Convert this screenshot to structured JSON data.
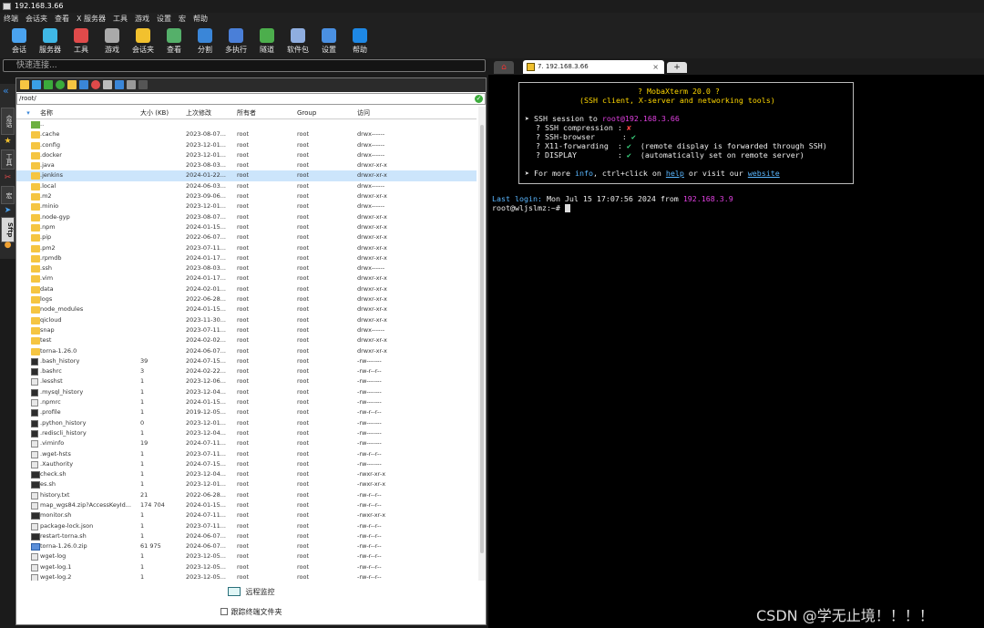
{
  "window": {
    "title": "192.168.3.66"
  },
  "menu": [
    "终端",
    "会话夹",
    "查看",
    "X 服务器",
    "工具",
    "游戏",
    "设置",
    "宏",
    "帮助"
  ],
  "toolbar": [
    {
      "label": "会话",
      "icon": "session-icon",
      "color": "#4aa3f0"
    },
    {
      "label": "服务器",
      "icon": "servers-icon",
      "color": "#3fb8e6"
    },
    {
      "label": "工具",
      "icon": "tools-icon",
      "color": "#e04a4a"
    },
    {
      "label": "游戏",
      "icon": "games-icon",
      "color": "#aaaaaa"
    },
    {
      "label": "会话夹",
      "icon": "star-icon",
      "color": "#f2c12e"
    },
    {
      "label": "查看",
      "icon": "view-icon",
      "color": "#55b06a"
    },
    {
      "label": "分割",
      "icon": "split-icon",
      "color": "#3a86d8"
    },
    {
      "label": "多执行",
      "icon": "multiexec-icon",
      "color": "#4a7fd8"
    },
    {
      "label": "隧道",
      "icon": "tunnel-icon",
      "color": "#4cae4c"
    },
    {
      "label": "软件包",
      "icon": "packages-icon",
      "color": "#8faee0"
    },
    {
      "label": "设置",
      "icon": "settings-icon",
      "color": "#4a90e2"
    },
    {
      "label": "帮助",
      "icon": "help-icon",
      "color": "#1e88e5"
    }
  ],
  "quick_connect": {
    "placeholder": "快速连接..."
  },
  "sidebar": {
    "tabs": [
      "会话",
      "工具",
      "宏",
      "Sftp"
    ]
  },
  "browser": {
    "path": "/root/",
    "columns": [
      "名称",
      "大小 (KB)",
      "上次修改",
      "所有者",
      "Group",
      "访问"
    ],
    "files": [
      {
        "name": "..",
        "size": "",
        "modified": "",
        "owner": "",
        "group": "",
        "access": "",
        "type": "up"
      },
      {
        "name": ".cache",
        "size": "",
        "modified": "2023-08-07...",
        "owner": "root",
        "group": "root",
        "access": "drwx------",
        "type": "folder"
      },
      {
        "name": ".config",
        "size": "",
        "modified": "2023-12-01...",
        "owner": "root",
        "group": "root",
        "access": "drwx------",
        "type": "folder"
      },
      {
        "name": ".docker",
        "size": "",
        "modified": "2023-12-01...",
        "owner": "root",
        "group": "root",
        "access": "drwx------",
        "type": "folder"
      },
      {
        "name": ".java",
        "size": "",
        "modified": "2023-08-03...",
        "owner": "root",
        "group": "root",
        "access": "drwxr-xr-x",
        "type": "folder"
      },
      {
        "name": ".jenkins",
        "size": "",
        "modified": "2024-01-22...",
        "owner": "root",
        "group": "root",
        "access": "drwxr-xr-x",
        "type": "folder",
        "selected": true
      },
      {
        "name": ".local",
        "size": "",
        "modified": "2024-06-03...",
        "owner": "root",
        "group": "root",
        "access": "drwx------",
        "type": "folder"
      },
      {
        "name": ".m2",
        "size": "",
        "modified": "2023-09-06...",
        "owner": "root",
        "group": "root",
        "access": "drwxr-xr-x",
        "type": "folder"
      },
      {
        "name": ".minio",
        "size": "",
        "modified": "2023-12-01...",
        "owner": "root",
        "group": "root",
        "access": "drwx------",
        "type": "folder"
      },
      {
        "name": ".node-gyp",
        "size": "",
        "modified": "2023-08-07...",
        "owner": "root",
        "group": "root",
        "access": "drwxr-xr-x",
        "type": "folder"
      },
      {
        "name": ".npm",
        "size": "",
        "modified": "2024-01-15...",
        "owner": "root",
        "group": "root",
        "access": "drwxr-xr-x",
        "type": "folder"
      },
      {
        "name": ".pip",
        "size": "",
        "modified": "2022-06-07...",
        "owner": "root",
        "group": "root",
        "access": "drwxr-xr-x",
        "type": "folder"
      },
      {
        "name": ".pm2",
        "size": "",
        "modified": "2023-07-11...",
        "owner": "root",
        "group": "root",
        "access": "drwxr-xr-x",
        "type": "folder"
      },
      {
        "name": ".rpmdb",
        "size": "",
        "modified": "2024-01-17...",
        "owner": "root",
        "group": "root",
        "access": "drwxr-xr-x",
        "type": "folder"
      },
      {
        "name": ".ssh",
        "size": "",
        "modified": "2023-08-03...",
        "owner": "root",
        "group": "root",
        "access": "drwx------",
        "type": "folder"
      },
      {
        "name": ".vim",
        "size": "",
        "modified": "2024-01-17...",
        "owner": "root",
        "group": "root",
        "access": "drwxr-xr-x",
        "type": "folder"
      },
      {
        "name": "data",
        "size": "",
        "modified": "2024-02-01...",
        "owner": "root",
        "group": "root",
        "access": "drwxr-xr-x",
        "type": "folder"
      },
      {
        "name": "logs",
        "size": "",
        "modified": "2022-06-28...",
        "owner": "root",
        "group": "root",
        "access": "drwxr-xr-x",
        "type": "folder"
      },
      {
        "name": "node_modules",
        "size": "",
        "modified": "2024-01-15...",
        "owner": "root",
        "group": "root",
        "access": "drwxr-xr-x",
        "type": "folder"
      },
      {
        "name": "qicloud",
        "size": "",
        "modified": "2023-11-30...",
        "owner": "root",
        "group": "root",
        "access": "drwxr-xr-x",
        "type": "folder"
      },
      {
        "name": "snap",
        "size": "",
        "modified": "2023-07-11...",
        "owner": "root",
        "group": "root",
        "access": "drwx------",
        "type": "folder"
      },
      {
        "name": "test",
        "size": "",
        "modified": "2024-02-02...",
        "owner": "root",
        "group": "root",
        "access": "drwxr-xr-x",
        "type": "folder"
      },
      {
        "name": "torna-1.26.0",
        "size": "",
        "modified": "2024-06-07...",
        "owner": "root",
        "group": "root",
        "access": "drwxr-xr-x",
        "type": "folder"
      },
      {
        "name": ".bash_history",
        "size": "39",
        "modified": "2024-07-15...",
        "owner": "root",
        "group": "root",
        "access": "-rw-------",
        "type": "dark"
      },
      {
        "name": ".bashrc",
        "size": "3",
        "modified": "2024-02-22...",
        "owner": "root",
        "group": "root",
        "access": "-rw-r--r--",
        "type": "dark"
      },
      {
        "name": ".lesshst",
        "size": "1",
        "modified": "2023-12-06...",
        "owner": "root",
        "group": "root",
        "access": "-rw-------",
        "type": "file"
      },
      {
        "name": ".mysql_history",
        "size": "1",
        "modified": "2023-12-04...",
        "owner": "root",
        "group": "root",
        "access": "-rw-------",
        "type": "dark"
      },
      {
        "name": ".npmrc",
        "size": "1",
        "modified": "2024-01-15...",
        "owner": "root",
        "group": "root",
        "access": "-rw-------",
        "type": "file"
      },
      {
        "name": ".profile",
        "size": "1",
        "modified": "2019-12-05...",
        "owner": "root",
        "group": "root",
        "access": "-rw-r--r--",
        "type": "dark"
      },
      {
        "name": ".python_history",
        "size": "0",
        "modified": "2023-12-01...",
        "owner": "root",
        "group": "root",
        "access": "-rw-------",
        "type": "dark"
      },
      {
        "name": ".rediscli_history",
        "size": "1",
        "modified": "2023-12-04...",
        "owner": "root",
        "group": "root",
        "access": "-rw-------",
        "type": "dark"
      },
      {
        "name": ".viminfo",
        "size": "19",
        "modified": "2024-07-11...",
        "owner": "root",
        "group": "root",
        "access": "-rw-------",
        "type": "file"
      },
      {
        "name": ".wget-hsts",
        "size": "1",
        "modified": "2023-07-11...",
        "owner": "root",
        "group": "root",
        "access": "-rw-r--r--",
        "type": "file"
      },
      {
        "name": ".Xauthority",
        "size": "1",
        "modified": "2024-07-15...",
        "owner": "root",
        "group": "root",
        "access": "-rw-------",
        "type": "file"
      },
      {
        "name": "check.sh",
        "size": "1",
        "modified": "2023-12-04...",
        "owner": "root",
        "group": "root",
        "access": "-rwxr-xr-x",
        "type": "sh"
      },
      {
        "name": "es.sh",
        "size": "1",
        "modified": "2023-12-01...",
        "owner": "root",
        "group": "root",
        "access": "-rwxr-xr-x",
        "type": "sh"
      },
      {
        "name": "history.txt",
        "size": "21",
        "modified": "2022-06-28...",
        "owner": "root",
        "group": "root",
        "access": "-rw-r--r--",
        "type": "file"
      },
      {
        "name": "map_wgs84.zip?AccessKeyId...",
        "size": "174 704",
        "modified": "2024-01-15...",
        "owner": "root",
        "group": "root",
        "access": "-rw-r--r--",
        "type": "file"
      },
      {
        "name": "monitor.sh",
        "size": "1",
        "modified": "2024-07-11...",
        "owner": "root",
        "group": "root",
        "access": "-rwxr-xr-x",
        "type": "sh"
      },
      {
        "name": "package-lock.json",
        "size": "1",
        "modified": "2023-07-11...",
        "owner": "root",
        "group": "root",
        "access": "-rw-r--r--",
        "type": "file"
      },
      {
        "name": "restart-torna.sh",
        "size": "1",
        "modified": "2024-06-07...",
        "owner": "root",
        "group": "root",
        "access": "-rw-r--r--",
        "type": "sh"
      },
      {
        "name": "torna-1.26.0.zip",
        "size": "61 975",
        "modified": "2024-06-07...",
        "owner": "root",
        "group": "root",
        "access": "-rw-r--r--",
        "type": "zip"
      },
      {
        "name": "wget-log",
        "size": "1",
        "modified": "2023-12-05...",
        "owner": "root",
        "group": "root",
        "access": "-rw-r--r--",
        "type": "file"
      },
      {
        "name": "wget-log.1",
        "size": "1",
        "modified": "2023-12-05...",
        "owner": "root",
        "group": "root",
        "access": "-rw-r--r--",
        "type": "file"
      },
      {
        "name": "wget-log.2",
        "size": "1",
        "modified": "2023-12-05...",
        "owner": "root",
        "group": "root",
        "access": "-rw-r--r--",
        "type": "file"
      }
    ],
    "remote_monitor": "远程监控",
    "follow_folder": "跟踪终端文件夹"
  },
  "tabs": {
    "session_tab": "7. 192.168.3.66",
    "close": "×",
    "new": "+"
  },
  "terminal": {
    "banner_title": "? MobaXterm 20.0 ?",
    "banner_sub": "(SSH client, X-server and networking tools)",
    "session_prefix": "➤ SSH session to ",
    "session_user": "root",
    "session_host": "@192.168.3.66",
    "compression": "? SSH compression : ",
    "compression_val": "✘",
    "browser": "? SSH-browser      : ",
    "browser_val": "✔",
    "x11": "? X11-forwarding  : ",
    "x11_val": "✔",
    "x11_note": "  (remote display is forwarded through SSH)",
    "display": "? DISPLAY         : ",
    "display_val": "✔",
    "display_note": "  (automatically set on remote server)",
    "more_prefix": "➤ For more ",
    "more_info": "info",
    "more_mid": ", ctrl+click on ",
    "more_help": "help",
    "more_or": " or visit our ",
    "more_site": "website",
    "last_login_label": "Last login:",
    "last_login_val": " Mon Jul 15 17:07:56 2024 from ",
    "last_login_ip": "192.168.3.9",
    "prompt": "root@wljslmz:~# "
  },
  "watermark": "CSDN @学无止境！！！！"
}
